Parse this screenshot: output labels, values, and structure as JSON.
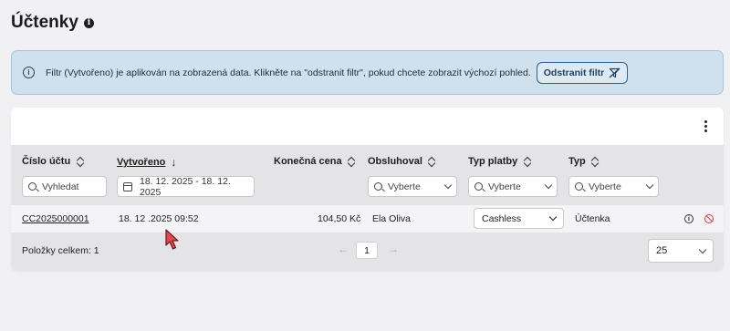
{
  "page": {
    "title": "Účtenky"
  },
  "alert": {
    "text": "Filtr (Vytvořeno) je aplikován na zobrazená data. Klikněte na \"odstranit filtr\", pokud chcete zobrazit výchozí pohled.",
    "button_label": "Odstranit filtr"
  },
  "table": {
    "columns": {
      "receipt_number": "Číslo účtu",
      "created": "Vytvořeno",
      "final_price": "Konečná cena",
      "served_by": "Obsluhoval",
      "payment_type": "Typ platby",
      "type": "Typ"
    },
    "filters": {
      "search_placeholder": "Vyhledat",
      "date_range": "18. 12. 2025 - 18. 12. 2025",
      "served_by_placeholder": "Vyberte",
      "payment_type_placeholder": "Vyberte",
      "type_placeholder": "Vyberte"
    },
    "rows": [
      {
        "receipt_number": "CC2025000001",
        "created": "18. 12 .2025 09:52",
        "final_price": "104,50 Kč",
        "served_by": "Ela Oliva",
        "payment_type": "Cashless",
        "type": "Účtenka"
      }
    ]
  },
  "footer": {
    "total_label": "Položky celkem: 1",
    "current_page": "1",
    "page_size": "25"
  },
  "colors": {
    "alert_bg": "#cfe0ee",
    "alert_border": "#a9c5dc",
    "alert_button_border": "#34618a",
    "header_bg": "#e4e4e6",
    "danger": "#d9363e"
  },
  "icons": [
    "info-icon",
    "filter-off-icon",
    "more-vertical-icon",
    "sort-icon",
    "arrow-down-icon",
    "search-icon",
    "calendar-icon",
    "chevron-down-icon",
    "block-icon",
    "arrow-left-icon",
    "arrow-right-icon",
    "mouse-cursor-icon"
  ]
}
